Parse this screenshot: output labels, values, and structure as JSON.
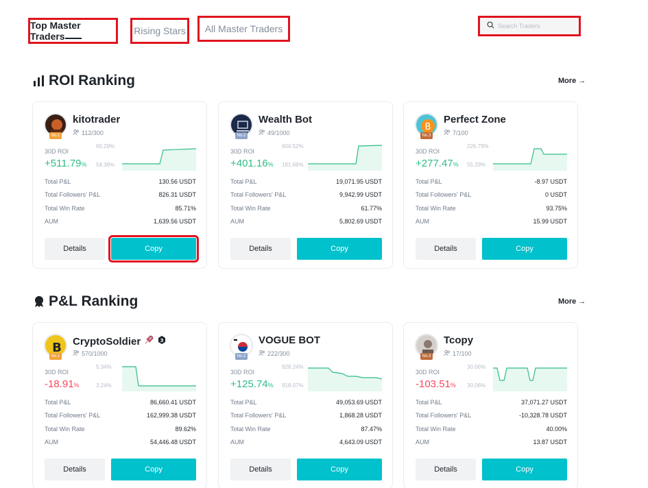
{
  "tabs": [
    {
      "label": "Top Master Traders",
      "active": true
    },
    {
      "label": "Rising Stars",
      "active": false
    },
    {
      "label": "All Master Traders",
      "active": false
    }
  ],
  "search": {
    "placeholder": "Search Traders"
  },
  "colors": {
    "accent": "#00c1cc",
    "positive": "#2ebd85",
    "negative": "#f6465d",
    "highlight": "#e0141e"
  },
  "sections": [
    {
      "title": "ROI Ranking",
      "icon": "bar-chart-icon",
      "more": "More",
      "cards": [
        {
          "name": "kitotrader",
          "rank": "No.1",
          "followers": "112/300",
          "roi_label": "30D ROI",
          "roi": "+511.79",
          "roi_unit": "%",
          "trend": "pos",
          "hi": "60.29%",
          "lo": "54.36%",
          "stats": [
            [
              "Total P&L",
              "130.56 USDT"
            ],
            [
              "Total Followers' P&L",
              "826.31 USDT"
            ],
            [
              "Total Win Rate",
              "85.71%"
            ],
            [
              "AUM",
              "1,639.56 USDT"
            ]
          ],
          "details": "Details",
          "copy": "Copy",
          "avatar": "avatar-dark"
        },
        {
          "name": "Wealth Bot",
          "rank": "No.2",
          "followers": "49/1000",
          "roi_label": "30D ROI",
          "roi": "+401.16",
          "roi_unit": "%",
          "trend": "pos",
          "hi": "604.52%",
          "lo": "181.68%",
          "stats": [
            [
              "Total P&L",
              "19,071.95 USDT"
            ],
            [
              "Total Followers' P&L",
              "9,942.99 USDT"
            ],
            [
              "Total Win Rate",
              "61.77%"
            ],
            [
              "AUM",
              "5,802.69 USDT"
            ]
          ],
          "details": "Details",
          "copy": "Copy",
          "avatar": "avatar-navy"
        },
        {
          "name": "Perfect Zone",
          "rank": "No.3",
          "followers": "7/100",
          "roi_label": "30D ROI",
          "roi": "+277.47",
          "roi_unit": "%",
          "trend": "pos",
          "hi": "226.79%",
          "lo": "55.29%",
          "stats": [
            [
              "Total P&L",
              "-8.97 USDT"
            ],
            [
              "Total Followers' P&L",
              "0 USDT"
            ],
            [
              "Total Win Rate",
              "93.75%"
            ],
            [
              "AUM",
              "15.99 USDT"
            ]
          ],
          "details": "Details",
          "copy": "Copy",
          "avatar": "avatar-bitcoin"
        }
      ]
    },
    {
      "title": "P&L Ranking",
      "icon": "medal-icon",
      "more": "More",
      "cards": [
        {
          "name": "CryptoSoldier",
          "rank": "No.1",
          "followers": "570/1000",
          "roi_label": "30D ROI",
          "roi": "-18.91",
          "roi_unit": "%",
          "trend": "neg",
          "hi": "5.34%",
          "lo": "3.24%",
          "stats": [
            [
              "Total P&L",
              "86,660.41 USDT"
            ],
            [
              "Total Followers' P&L",
              "162,999.38 USDT"
            ],
            [
              "Total Win Rate",
              "89.62%"
            ],
            [
              "AUM",
              "54,446.48 USDT"
            ]
          ],
          "details": "Details",
          "copy": "Copy",
          "avatar": "avatar-yellow"
        },
        {
          "name": "VOGUE BOT",
          "rank": "No.2",
          "followers": "222/300",
          "roi_label": "30D ROI",
          "roi": "+125.74",
          "roi_unit": "%",
          "trend": "pos",
          "hi": "928.24%",
          "lo": "918.07%",
          "stats": [
            [
              "Total P&L",
              "49,053.69 USDT"
            ],
            [
              "Total Followers' P&L",
              "1,868.28 USDT"
            ],
            [
              "Total Win Rate",
              "87.47%"
            ],
            [
              "AUM",
              "4,643.09 USDT"
            ]
          ],
          "details": "Details",
          "copy": "Copy",
          "avatar": "avatar-korea"
        },
        {
          "name": "Tcopy",
          "rank": "No.3",
          "followers": "17/100",
          "roi_label": "30D ROI",
          "roi": "-103.51",
          "roi_unit": "%",
          "trend": "neg",
          "hi": "30.06%",
          "lo": "30.06%",
          "stats": [
            [
              "Total P&L",
              "37,071.27 USDT"
            ],
            [
              "Total Followers' P&L",
              "-10,328.78 USDT"
            ],
            [
              "Total Win Rate",
              "40.00%"
            ],
            [
              "AUM",
              "13.87 USDT"
            ]
          ],
          "details": "Details",
          "copy": "Copy",
          "avatar": "avatar-portrait"
        }
      ]
    }
  ]
}
